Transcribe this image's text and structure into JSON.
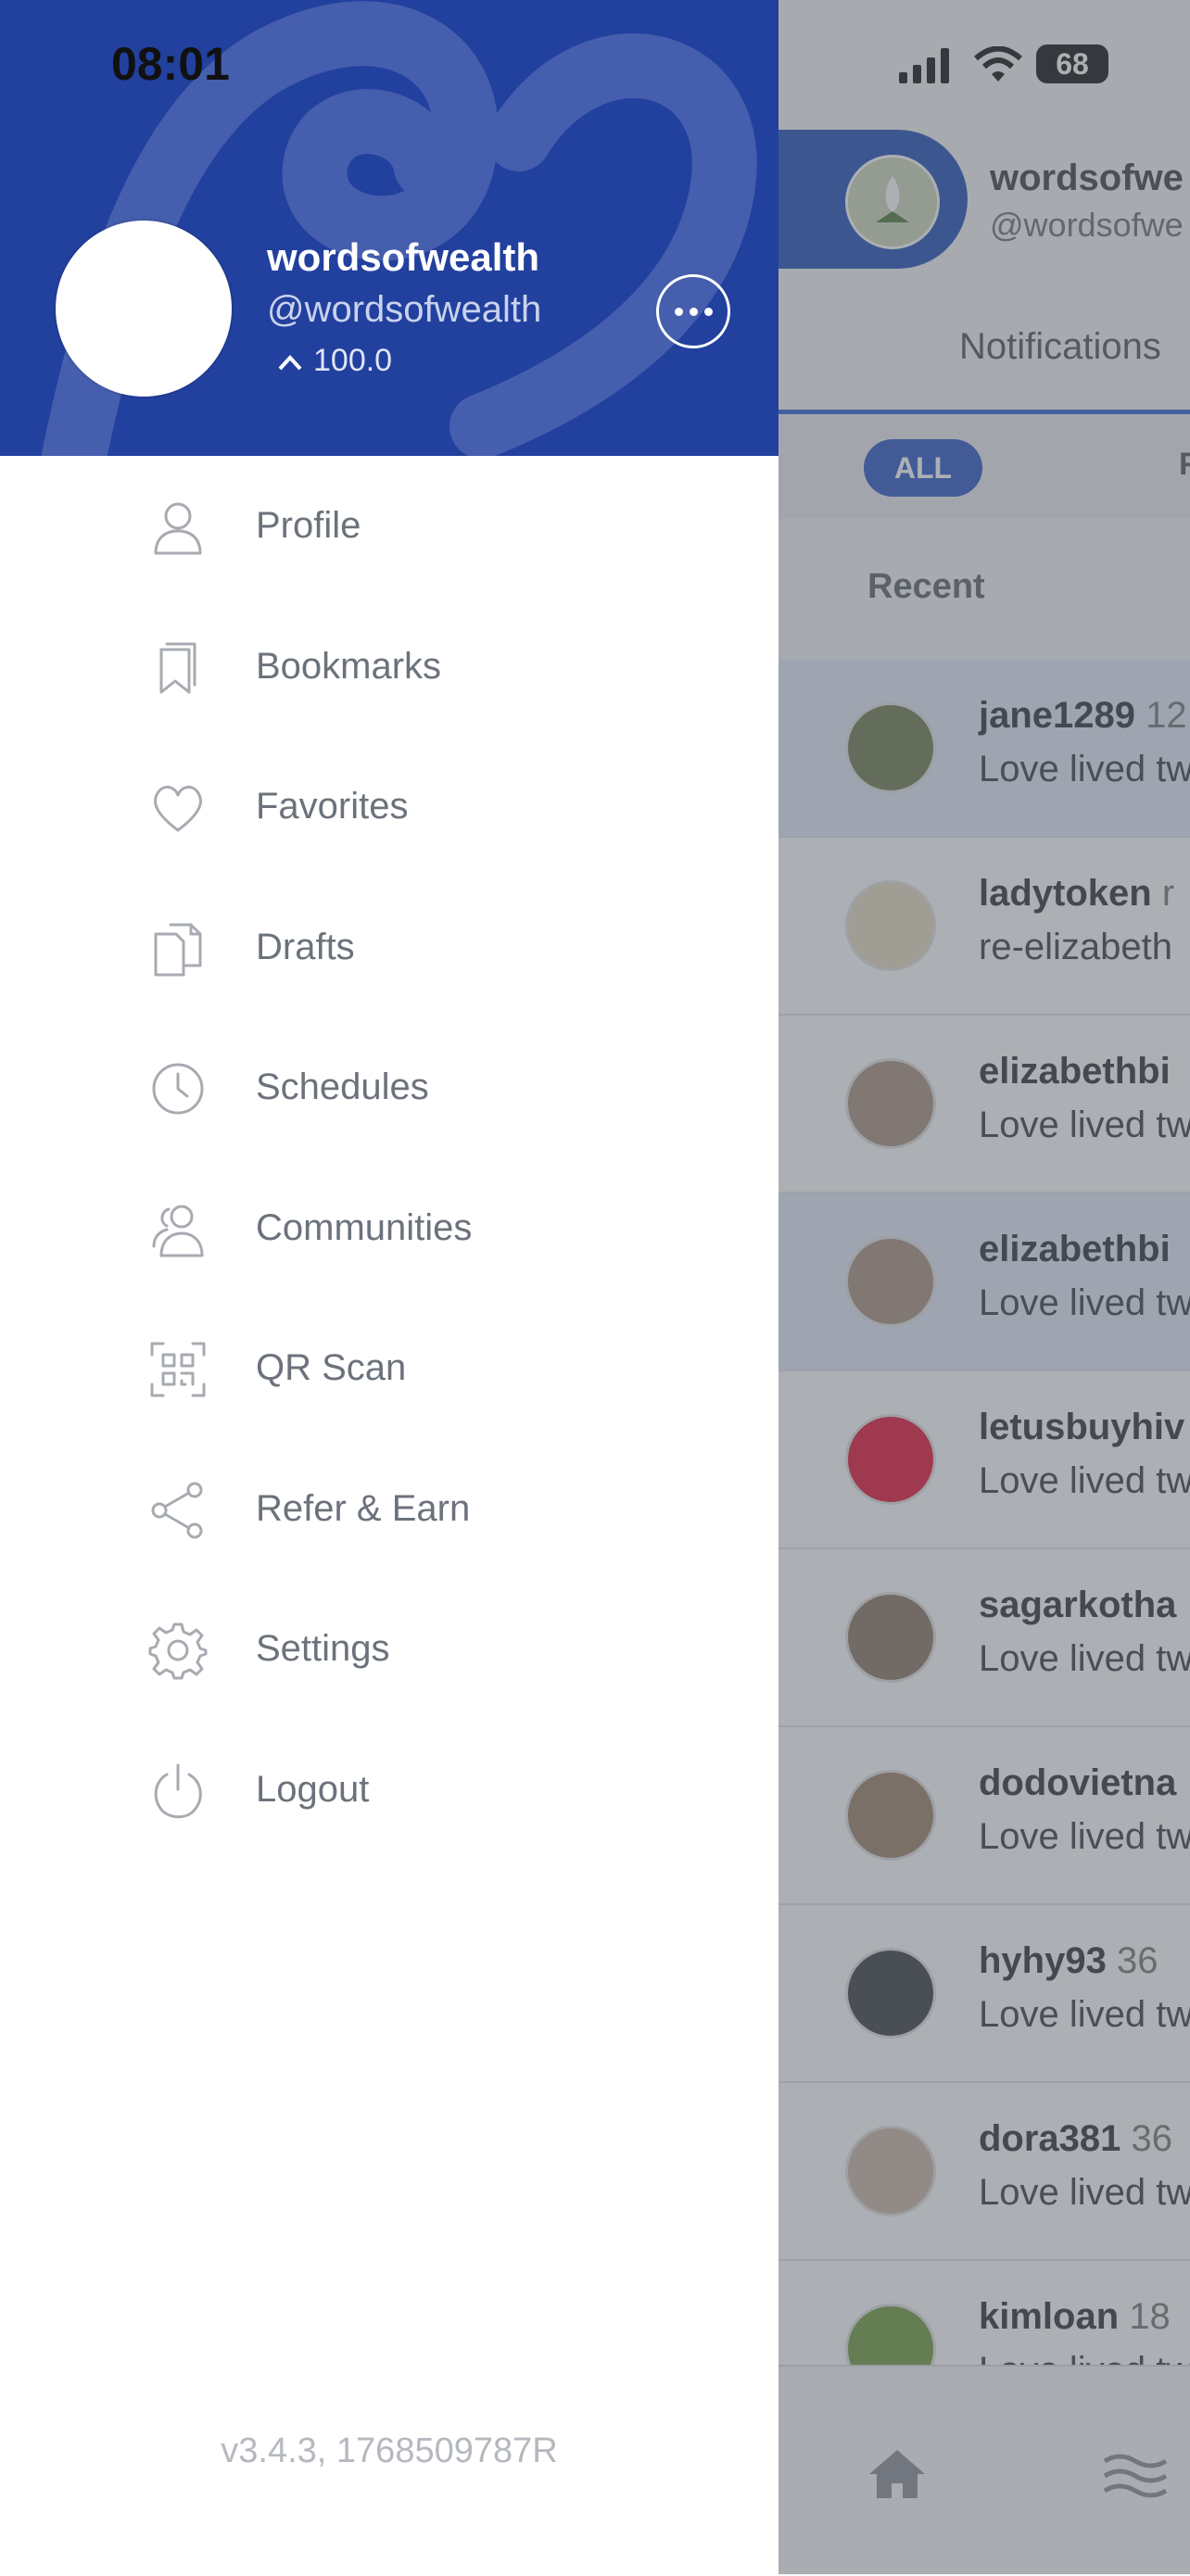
{
  "status_bar": {
    "time": "08:01",
    "battery": "68"
  },
  "drawer": {
    "user": {
      "name": "wordsofwealth",
      "handle": "@wordsofwealth",
      "reputation": "100.0"
    },
    "menu": [
      {
        "label": "Profile",
        "icon": "profile-icon"
      },
      {
        "label": "Bookmarks",
        "icon": "bookmark-icon"
      },
      {
        "label": "Favorites",
        "icon": "heart-icon"
      },
      {
        "label": "Drafts",
        "icon": "drafts-icon"
      },
      {
        "label": "Schedules",
        "icon": "clock-icon"
      },
      {
        "label": "Communities",
        "icon": "communities-icon"
      },
      {
        "label": "QR Scan",
        "icon": "qr-icon"
      },
      {
        "label": "Refer & Earn",
        "icon": "share-icon"
      },
      {
        "label": "Settings",
        "icon": "gear-icon"
      },
      {
        "label": "Logout",
        "icon": "power-icon"
      }
    ],
    "version": "v3.4.3, 1768509787R"
  },
  "background_app": {
    "header": {
      "name": "wordsofwe",
      "handle": "@wordsofwe"
    },
    "tab": "Notifications",
    "filters": {
      "active": "ALL",
      "next": "F"
    },
    "section_title": "Recent",
    "notifications": [
      {
        "user": "jane1289",
        "pct": "12",
        "message": "Love lived tw",
        "unread": true,
        "avatar_color": "#6f7b4f"
      },
      {
        "user": "ladytoken",
        "pct": "r",
        "message": "re-elizabeth",
        "unread": false,
        "avatar_color": "#e7ddc1"
      },
      {
        "user": "elizabethbi",
        "pct": "",
        "message": "Love lived tw",
        "unread": false,
        "avatar_color": "#a88f7e"
      },
      {
        "user": "elizabethbi",
        "pct": "",
        "message": "Love lived tw",
        "unread": true,
        "avatar_color": "#a88f7e"
      },
      {
        "user": "letusbuyhiv",
        "pct": "",
        "message": "Love lived tw",
        "unread": false,
        "avatar_color": "#e31337"
      },
      {
        "user": "sagarkotha",
        "pct": "",
        "message": "Love lived tw",
        "unread": false,
        "avatar_color": "#8a7560"
      },
      {
        "user": "dodovietna",
        "pct": "",
        "message": "Love lived tw",
        "unread": false,
        "avatar_color": "#9c8068"
      },
      {
        "user": "hyhy93",
        "pct": "36",
        "message": "Love lived tw",
        "unread": false,
        "avatar_color": "#3a3f45"
      },
      {
        "user": "dora381",
        "pct": "36",
        "message": "Love lived tw",
        "unread": false,
        "avatar_color": "#c9b5a5"
      },
      {
        "user": "kimloan",
        "pct": "18",
        "message": "Love lived tw",
        "unread": false,
        "avatar_color": "#6f9a3f"
      }
    ]
  }
}
